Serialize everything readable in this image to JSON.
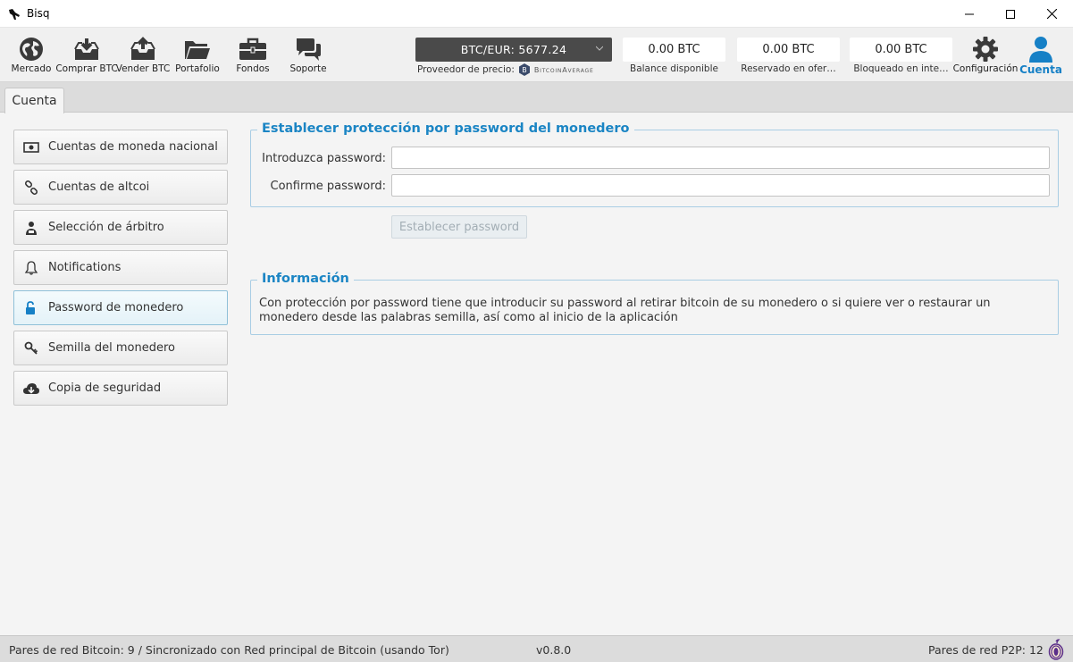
{
  "window": {
    "title": "Bisq",
    "app_icon": "bisq-logo-icon"
  },
  "nav": {
    "items": [
      {
        "label": "Mercado",
        "icon": "globe-icon"
      },
      {
        "label": "Comprar BTC",
        "icon": "buy-box-icon"
      },
      {
        "label": "Vender BTC",
        "icon": "sell-box-icon"
      },
      {
        "label": "Portafolio",
        "icon": "folder-icon"
      },
      {
        "label": "Fondos",
        "icon": "briefcase-icon"
      },
      {
        "label": "Soporte",
        "icon": "chat-bubbles-icon"
      }
    ],
    "settings_label": "Configuración",
    "account_label": "Cuenta"
  },
  "price": {
    "pair_label": "BTC/EUR: 5677.24",
    "provider_label": "Proveedor de precio:",
    "provider_name": "BitcoinAverage"
  },
  "balances": [
    {
      "value": "0.00 BTC",
      "label": "Balance disponible"
    },
    {
      "value": "0.00 BTC",
      "label": "Reservado en ofer…"
    },
    {
      "value": "0.00 BTC",
      "label": "Bloqueado en inte…"
    }
  ],
  "tabs": [
    {
      "label": "Cuenta"
    }
  ],
  "menu": {
    "items": [
      {
        "label": "Cuentas de moneda nacional",
        "icon": "banknote-icon"
      },
      {
        "label": "Cuentas de altcoi",
        "icon": "link-icon"
      },
      {
        "label": "Selección de árbitro",
        "icon": "arbitrator-icon"
      },
      {
        "label": "Notifications",
        "icon": "bell-icon"
      },
      {
        "label": "Password de monedero",
        "icon": "unlock-icon"
      },
      {
        "label": "Semilla del monedero",
        "icon": "key-icon"
      },
      {
        "label": "Copia de seguridad",
        "icon": "cloud-download-icon"
      }
    ],
    "selected": "Password de monedero"
  },
  "password_form": {
    "title": "Establecer protección por password del monedero",
    "enter_label": "Introduzca password:",
    "enter_value": "",
    "confirm_label": "Confirme password:",
    "confirm_value": "",
    "button_label": "Establecer password"
  },
  "info": {
    "title": "Información",
    "text": "Con protección por password tiene que introducir su password al retirar bitcoin de su monedero o si quiere ver o restaurar un monedero desde las palabras semilla, así como al inicio de la aplicación"
  },
  "status": {
    "btc_network": "Pares de red Bitcoin: 9 / Sincronizado con Red principal de Bitcoin (usando Tor)",
    "version": "v0.8.0",
    "p2p_peers": "Pares de red P2P: 12"
  },
  "colors": {
    "accent": "#1b85c4",
    "price_box": "#4a4a4a",
    "selected_menu_border": "#8fc0d8"
  }
}
